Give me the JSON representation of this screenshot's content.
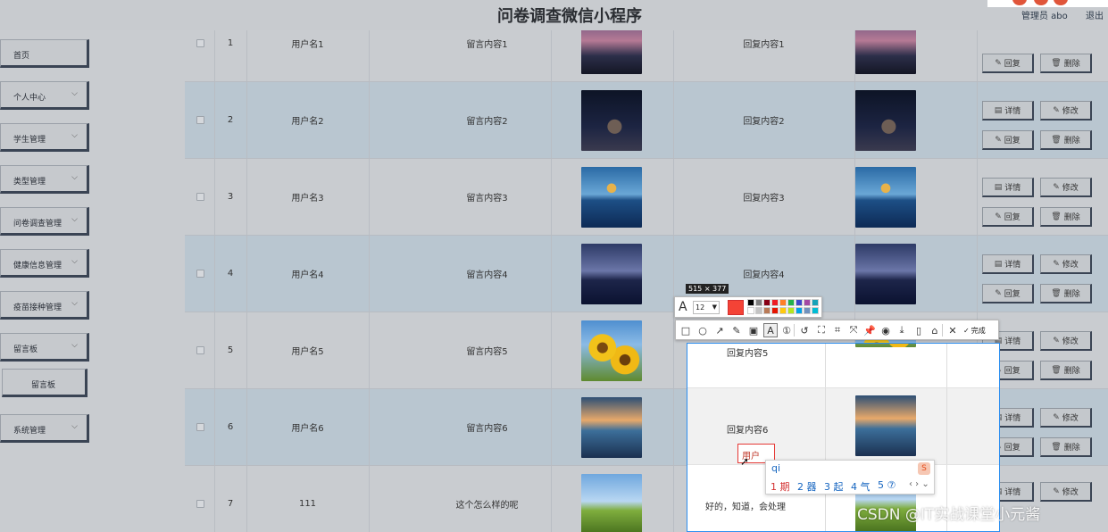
{
  "header": {
    "app_title": "问卷调查微信小程序",
    "user_label": "管理员 abo",
    "logout_label": "退出"
  },
  "sidebar": {
    "items": [
      {
        "label": "首页",
        "chevron": false
      },
      {
        "label": "个人中心",
        "chevron": true
      },
      {
        "label": "学生管理",
        "chevron": true
      },
      {
        "label": "类型管理",
        "chevron": true
      },
      {
        "label": "问卷调查管理",
        "chevron": true
      },
      {
        "label": "健康信息管理",
        "chevron": true
      },
      {
        "label": "疫苗接种管理",
        "chevron": true
      },
      {
        "label": "留言板",
        "chevron": true
      },
      {
        "label": "留言板",
        "chevron": false,
        "sub": true
      },
      {
        "label": "系统管理",
        "chevron": true
      }
    ],
    "chevron_glyph": "⌵"
  },
  "table": {
    "rows": [
      {
        "index": "1",
        "username": "用户名1",
        "message": "留言内容1",
        "reply": "回复内容1",
        "image": "img-dusk",
        "buttons": [
          "回复",
          "删除"
        ]
      },
      {
        "index": "2",
        "username": "用户名2",
        "message": "留言内容2",
        "reply": "回复内容2",
        "image": "img-space",
        "buttons": [
          "详情",
          "修改",
          "回复",
          "删除"
        ]
      },
      {
        "index": "3",
        "username": "用户名3",
        "message": "留言内容3",
        "reply": "回复内容3",
        "image": "img-lake",
        "buttons": [
          "详情",
          "修改",
          "回复",
          "删除"
        ]
      },
      {
        "index": "4",
        "username": "用户名4",
        "message": "留言内容4",
        "reply": "回复内容4",
        "image": "img-pier",
        "buttons": [
          "详情",
          "修改",
          "回复",
          "删除"
        ]
      },
      {
        "index": "5",
        "username": "用户名5",
        "message": "留言内容5",
        "reply": "回复内容5",
        "image": "img-sun",
        "buttons": [
          "详情",
          "修改",
          "回复",
          "删除"
        ]
      },
      {
        "index": "6",
        "username": "用户名6",
        "message": "留言内容6",
        "reply": "回复内容6",
        "image": "img-boat",
        "buttons": [
          "详情",
          "修改",
          "回复",
          "删除"
        ]
      },
      {
        "index": "7",
        "username": "111",
        "message": "这个怎么样的呢",
        "reply": "好的，知道，会处理",
        "image": "img-field",
        "buttons": [
          "详情",
          "修改"
        ]
      }
    ],
    "button_icons": {
      "详情": "▤",
      "修改": "✎",
      "回复": "✎",
      "删除": "🗑"
    }
  },
  "screenshot_tool": {
    "size_label": "515 × 377",
    "font_size": "12",
    "current_color": "#f44336",
    "palette": [
      "#000000",
      "#7f7f7f",
      "#880015",
      "#ed1c24",
      "#ff7f27",
      "#22b14c",
      "#3f48cc",
      "#a349a4",
      "#17a2b8",
      "#ffffff",
      "#c3c3c3",
      "#b97a57",
      "#e51400",
      "#ffc90e",
      "#b5e61d",
      "#00a2e8",
      "#7092be",
      "#00bcd4"
    ],
    "tools": [
      "rectangle-tool",
      "ellipse-tool",
      "arrow-tool",
      "pen-tool",
      "mosaic-tool",
      "text-tool",
      "number-tool",
      "undo-tool",
      "pin-tool",
      "ocr-tool",
      "translate-tool",
      "pin-top-tool",
      "record-tool",
      "save-tool",
      "long-screenshot-tool",
      "bookmark-tool",
      "cancel-tool"
    ],
    "tool_glyphs": [
      "□",
      "○",
      "↗",
      "✎",
      "▣",
      "A",
      "①",
      "↺",
      "⛶",
      "⌗",
      "⤧",
      "📌",
      "◉",
      "⤓",
      "▯",
      "⌂",
      "✕"
    ],
    "done_label": "完成",
    "text_box_value": "用户"
  },
  "ime": {
    "input": "qi",
    "candidates": [
      "1 期",
      "2 器",
      "3 起",
      "4 气",
      "5 ⑦"
    ],
    "logo": "S",
    "nav": "‹ › ⌄"
  },
  "watermark": "CSDN @IT实战课堂小元酱"
}
